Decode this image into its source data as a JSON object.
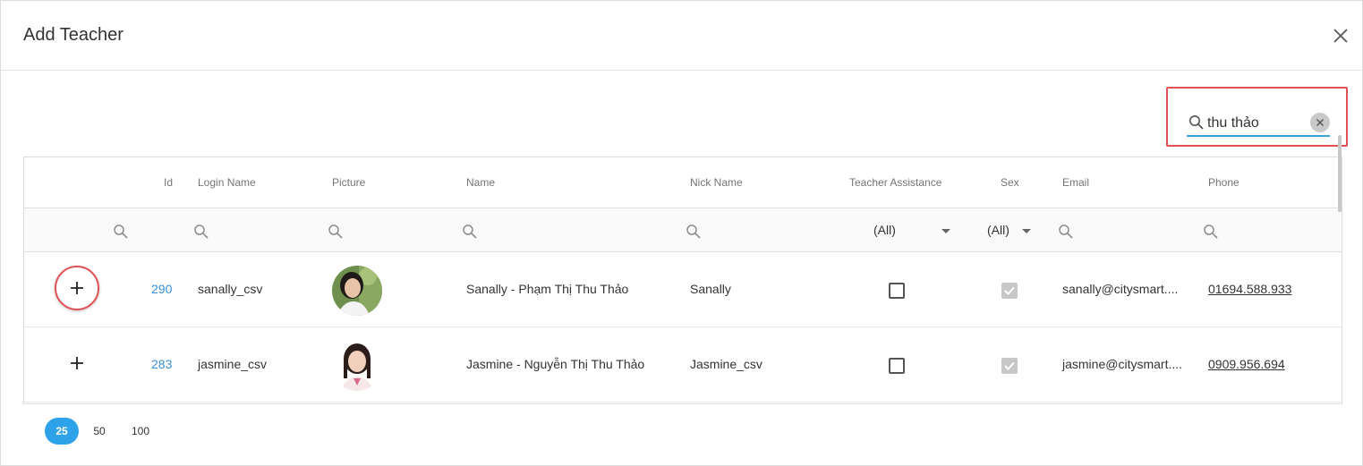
{
  "dialog": {
    "title": "Add Teacher"
  },
  "search": {
    "value": "thu thảo"
  },
  "columns": [
    "Id",
    "Login Name",
    "Picture",
    "Name",
    "Nick Name",
    "Teacher Assistance",
    "Sex",
    "Email",
    "Phone"
  ],
  "filters": {
    "teacher_assistance": "(All)",
    "sex": "(All)"
  },
  "rows": [
    {
      "id": "290",
      "login": "sanally_csv",
      "name": "Sanally - Phạm Thị Thu Thảo",
      "nick": "Sanally",
      "teacher_assistance": false,
      "sex": true,
      "email": "sanally@citysmart....",
      "phone": "01694.588.933"
    },
    {
      "id": "283",
      "login": "jasmine_csv",
      "name": "Jasmine - Nguyễn Thị Thu Thảo",
      "nick": "Jasmine_csv",
      "teacher_assistance": false,
      "sex": true,
      "email": "jasmine@citysmart....",
      "phone": "0909.956.694"
    }
  ],
  "pager": {
    "sizes": [
      "25",
      "50",
      "100"
    ],
    "active": "25"
  },
  "colors": {
    "accent": "#2ea2e8",
    "highlight": "#e05054",
    "link": "#3a8fd6"
  }
}
